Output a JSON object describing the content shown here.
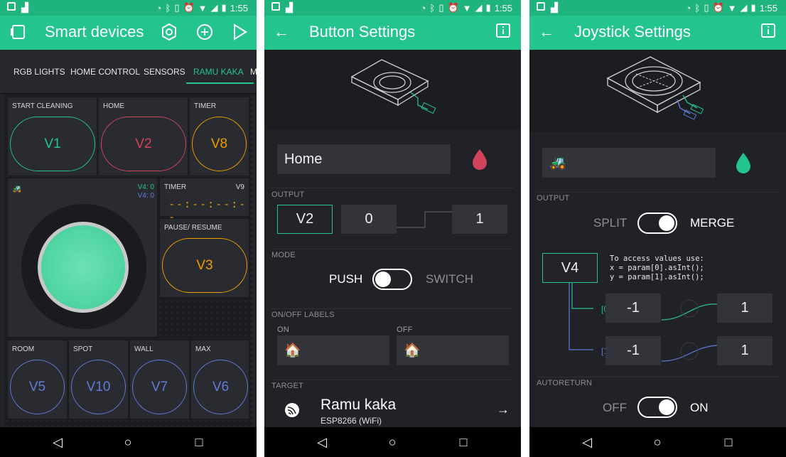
{
  "status": {
    "time": "1:55"
  },
  "screen1": {
    "title": "Smart devices",
    "tabs": [
      "RGB LIGHTS",
      "HOME CONTROL",
      "SENSORS",
      "RAMU KAKA",
      "M"
    ],
    "widgets": {
      "start": {
        "label": "START CLEANING",
        "pin": "V1",
        "color": "#23c48e"
      },
      "home": {
        "label": "HOME",
        "pin": "V2",
        "color": "#d3435c"
      },
      "timer_top": {
        "label": "TIMER",
        "pin": "V8",
        "color": "#ed9d00"
      },
      "joystick": {
        "x_readout": "V4: 0",
        "y_readout": "V4: 0"
      },
      "timer": {
        "label": "TIMER",
        "pin": "V9",
        "value": "--:--:--:--"
      },
      "pause": {
        "label": "PAUSE/ RESUME",
        "pin": "V3",
        "color": "#ed9d00"
      },
      "room": {
        "label": "ROOM",
        "pin": "V5"
      },
      "spot": {
        "label": "SPOT",
        "pin": "V10"
      },
      "wall": {
        "label": "WALL",
        "pin": "V7"
      },
      "max": {
        "label": "MAX",
        "pin": "V6"
      }
    },
    "blue": "#5f7cd8"
  },
  "screen2": {
    "title": "Button Settings",
    "name": "Home",
    "drop_color": "#d3435c",
    "output_label": "OUTPUT",
    "pin": "V2",
    "low": "0",
    "high": "1",
    "mode_label": "MODE",
    "push": "PUSH",
    "switch": "SWITCH",
    "labels_label": "ON/OFF LABELS",
    "on": "ON",
    "off": "OFF",
    "target_label": "TARGET",
    "device_name": "Ramu kaka",
    "device_type": "ESP8266 (WiFi)"
  },
  "screen3": {
    "title": "Joystick Settings",
    "drop_color": "#23c48e",
    "output_label": "OUTPUT",
    "split": "SPLIT",
    "merge": "MERGE",
    "pin": "V4",
    "code": [
      "To access values use:",
      "x = param[0].asInt();",
      "y = param[1].asInt();"
    ],
    "idx0": "[0]",
    "idx1": "[1]",
    "x_min": "-1",
    "x_max": "1",
    "y_min": "-1",
    "y_max": "1",
    "autoreturn_label": "AUTORETURN",
    "off": "OFF",
    "on": "ON"
  }
}
